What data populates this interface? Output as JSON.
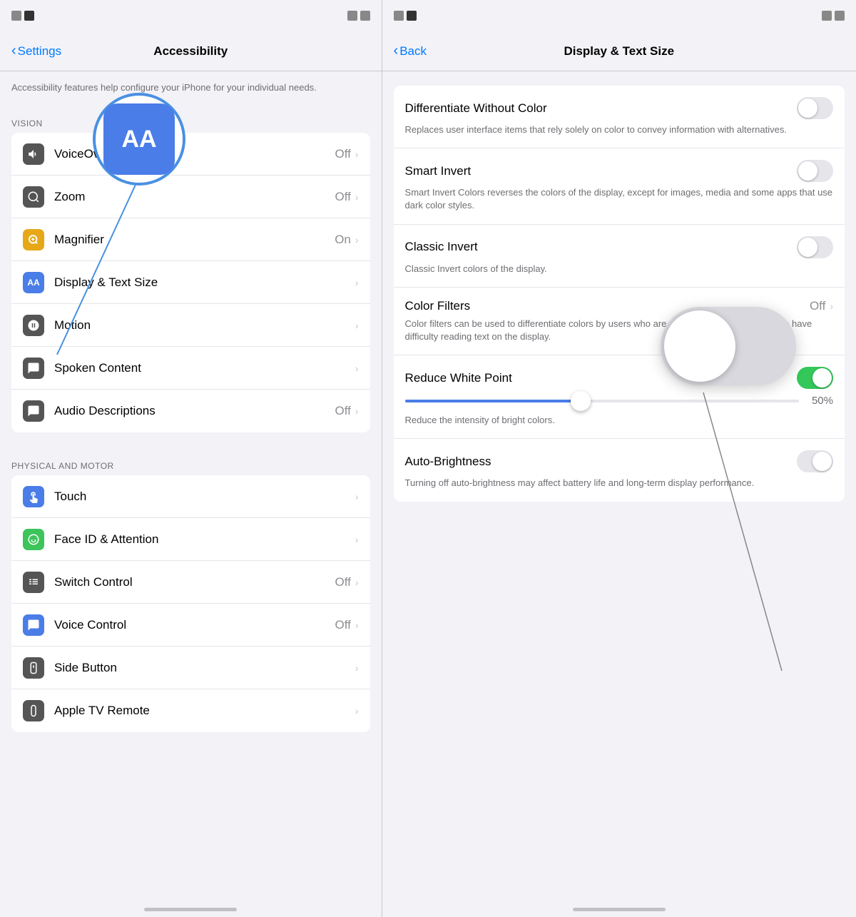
{
  "left": {
    "status": {
      "left_squares": [
        "gray",
        "dark"
      ],
      "right_squares": [
        "gray",
        "gray"
      ]
    },
    "nav": {
      "back_label": "Settings",
      "title": "Accessibility"
    },
    "description": "Accessibility features help   your iPhone for your individual needs.",
    "sections": [
      {
        "id": "vision",
        "header": "VISION",
        "items": [
          {
            "id": "voiceover",
            "icon_bg": "#555",
            "icon_symbol": "🔊",
            "label": "VoiceOver",
            "value": "Off",
            "has_chevron": true
          },
          {
            "id": "zoom",
            "icon_bg": "#555",
            "icon_symbol": "⊙",
            "label": "Zoom",
            "value": "Off",
            "has_chevron": true
          },
          {
            "id": "magnifier",
            "icon_bg": "#e6a817",
            "icon_symbol": "🔍",
            "label": "Magnifier",
            "value": "On",
            "has_chevron": true
          },
          {
            "id": "display-text-size",
            "icon_bg": "#4a7de8",
            "icon_symbol": "AA",
            "label": "Display & Text Size",
            "value": "",
            "has_chevron": true,
            "highlighted": true
          },
          {
            "id": "motion",
            "icon_bg": "#555",
            "icon_symbol": "≋",
            "label": "Motion",
            "value": "",
            "has_chevron": true
          },
          {
            "id": "spoken-content",
            "icon_bg": "#555",
            "icon_symbol": "💬",
            "label": "Spoken Content",
            "value": "",
            "has_chevron": true
          },
          {
            "id": "audio-descriptions",
            "icon_bg": "#555",
            "icon_symbol": "💬",
            "label": "Audio Descriptions",
            "value": "Off",
            "has_chevron": true
          }
        ]
      },
      {
        "id": "physical-motor",
        "header": "PHYSICAL AND MOTOR",
        "items": [
          {
            "id": "touch",
            "icon_bg": "#4a7de8",
            "icon_symbol": "✋",
            "label": "Touch",
            "value": "",
            "has_chevron": true
          },
          {
            "id": "face-id-attention",
            "icon_bg": "#3dc45a",
            "icon_symbol": "😊",
            "label": "Face ID & Attention",
            "value": "",
            "has_chevron": true
          },
          {
            "id": "switch-control",
            "icon_bg": "#555",
            "icon_symbol": "⊞",
            "label": "Switch Control",
            "value": "Off",
            "has_chevron": true
          },
          {
            "id": "voice-control",
            "icon_bg": "#4a7de8",
            "icon_symbol": "💬",
            "label": "Voice Control",
            "value": "Off",
            "has_chevron": true
          },
          {
            "id": "side-button",
            "icon_bg": "#555",
            "icon_symbol": "⏎",
            "label": "Side Button",
            "value": "",
            "has_chevron": true
          },
          {
            "id": "apple-tv-remote",
            "icon_bg": "#555",
            "icon_symbol": "📱",
            "label": "Apple TV Remote",
            "value": "",
            "has_chevron": true
          }
        ]
      }
    ],
    "aa_bubble": {
      "text": "AA"
    }
  },
  "right": {
    "status": {
      "left_squares": [
        "gray",
        "dark"
      ],
      "right_squares": [
        "gray",
        "gray"
      ]
    },
    "nav": {
      "back_label": "Back",
      "title": "Display & Text Size"
    },
    "settings": [
      {
        "id": "differentiate-without-color",
        "label": "Differentiate Without Color",
        "toggle": "off",
        "description": "Replaces user interface items that rely solely on color to convey information with alternatives."
      },
      {
        "id": "smart-invert",
        "label": "Smart Invert",
        "toggle": "off",
        "description": "Smart Invert Colors reverses the colors of the display, except for images, media and some apps that use dark color styles."
      },
      {
        "id": "classic-invert",
        "label": "Classic Invert",
        "toggle": "off",
        "description": "Classic Invert   colors of the display."
      },
      {
        "id": "color-filters",
        "label": "Color Filters",
        "value": "Off",
        "has_chevron": true,
        "description": "Color filters can be used to differentiate colors by users who are color blind and aid users who have difficulty reading text on the display."
      },
      {
        "id": "reduce-white-point",
        "label": "Reduce White Point",
        "toggle": "on",
        "slider_value": "50%",
        "description": "Reduce the intensity of bright colors."
      },
      {
        "id": "auto-brightness",
        "label": "Auto-Brightness",
        "toggle": "turning-off",
        "description": "Turning off auto-brightness may affect battery life and long-term display performance."
      }
    ]
  }
}
